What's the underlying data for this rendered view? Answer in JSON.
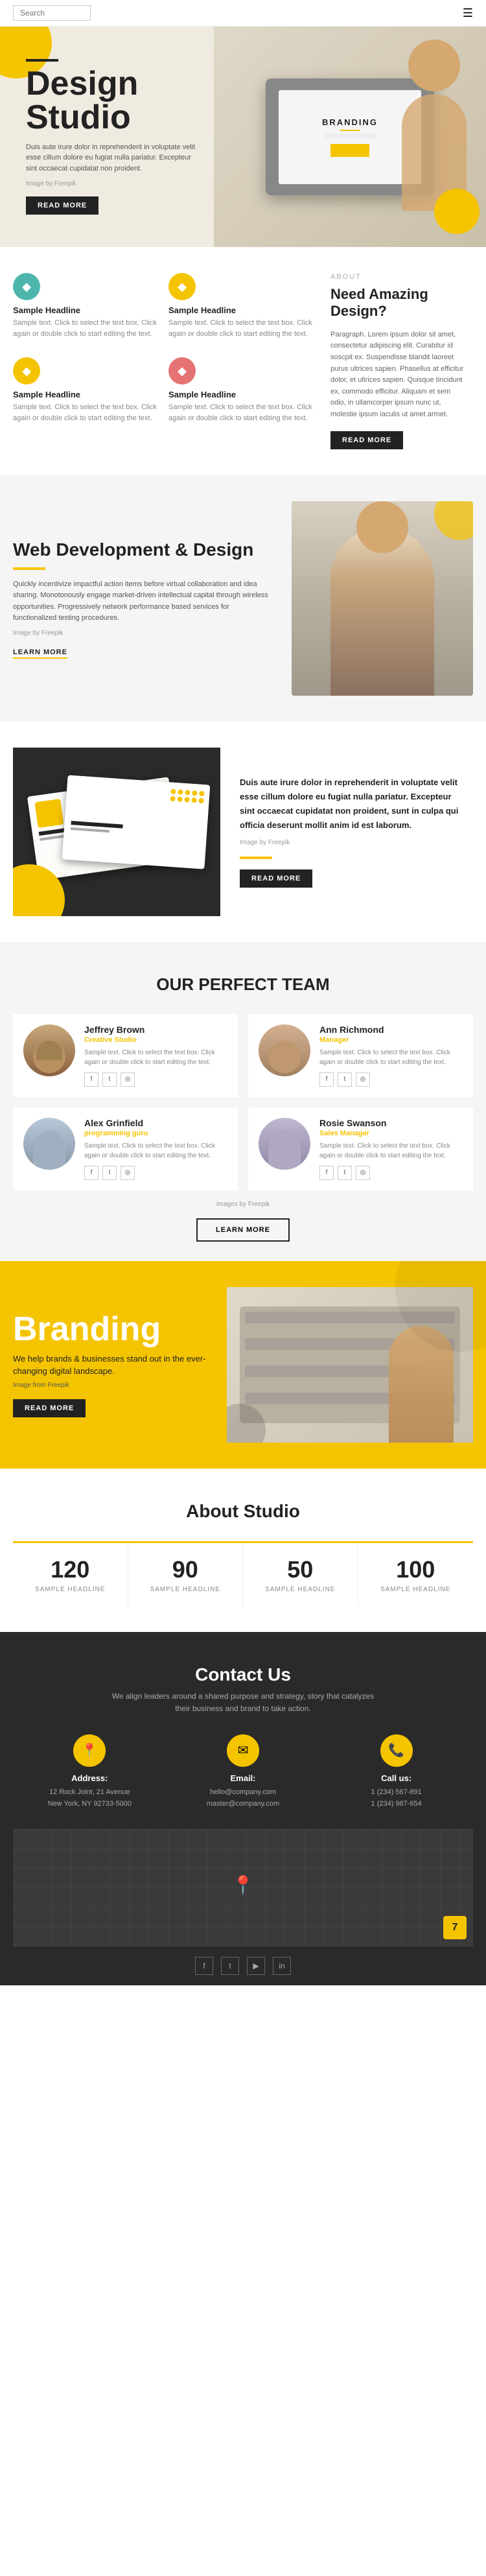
{
  "header": {
    "search_placeholder": "Search",
    "menu_icon": "☰"
  },
  "hero": {
    "title_line1": "Design",
    "title_line2": "Studio",
    "tagline": "Duis aute irure dolor in reprehenderit in voluptate velit esse cillum dolore eu fugiat nulla pariatur. Excepteur sint occaecat cupidatat non proident.",
    "credit": "Image by Freepik",
    "btn_label": "READ MORE",
    "laptop_label": "BRANDING"
  },
  "features": {
    "items_left": [
      {
        "icon": "◆",
        "icon_color": "green",
        "title": "Sample Headline",
        "text": "Sample text. Click to select the text box. Click again or double click to start editing the text."
      },
      {
        "icon": "◆",
        "icon_color": "yellow",
        "title": "Sample Headline",
        "text": "Sample text. Click to select the text box. Click again or double click to start editing the text."
      }
    ],
    "items_middle": [
      {
        "icon": "◆",
        "icon_color": "yellow",
        "title": "Sample Headline",
        "text": "Sample text. Click to select the text box. Click again or double click to start editing the text."
      },
      {
        "icon": "◆",
        "icon_color": "red",
        "title": "Sample Headline",
        "text": "Sample text. Click to select the text box. Click again or double click to start editing the text."
      }
    ],
    "about": {
      "label": "ABOUT",
      "title": "Need Amazing Design?",
      "text": "Paragraph. Lorem ipsum dolor sit amet, consectetur adipiscing elit. Curabitur id soscpit ex. Suspendisse blandit laoreet purus ultrices sapien. Phasellus at efficitur dolor, et ultrices sapien. Quisque tincidunt ex, commodo efficitur. Aliquam et sem odio, in ullamcorper ipsum nunc ut, molestie ipsum iaculis ut amet armet.",
      "btn_label": "READ MORE"
    }
  },
  "webdev": {
    "title": "Web Development & Design",
    "text1": "Quickly incentivize impactful action items before virtual collaboration and idea sharing. Monotonously engage market-driven intellectual capital through wireless opportunities. Progressively network performance based services for functionalized testing procedures.",
    "credit": "Image by Freepik",
    "learn_label": "LEARN MORE"
  },
  "branding_block": {
    "text": "Duis aute irure dolor in reprehenderit in voluptate velit esse cillum dolore eu fugiat nulla pariatur. Excepteur sint occaecat cupidatat non proident, sunt in culpa qui officia deserunt mollit anim id est laborum.",
    "credit": "Image by Freepik",
    "btn_label": "READ MORE"
  },
  "team": {
    "section_title": "OUR PERFECT TEAM",
    "members": [
      {
        "name": "Jeffrey Brown",
        "role": "Creative Studio",
        "desc": "Sample text. Click to select the text box. Click again or double click to start editing the text.",
        "avatar_type": "male"
      },
      {
        "name": "Ann Richmond",
        "role": "Manager",
        "desc": "Sample text. Click to select the text box. Click again or double click to start editing the text.",
        "avatar_type": "female"
      },
      {
        "name": "Alex Grinfield",
        "role": "programming guru",
        "desc": "Sample text. Click to select the text box. Click again or double click to start editing the text.",
        "avatar_type": "male2"
      },
      {
        "name": "Rosie Swanson",
        "role": "Sales Manager",
        "desc": "Sample text. Click to select the text box. Click again or double click to start editing the text.",
        "avatar_type": "female2"
      }
    ],
    "credit": "Images by Freepik",
    "btn_label": "LEARN MORE"
  },
  "branding_section": {
    "heading": "Branding",
    "sub": "We help brands & businesses stand out in the ever-changing digital landscape.",
    "credit": "Image from Freepik",
    "btn_label": "READ MORE"
  },
  "about_studio": {
    "title": "About Studio",
    "stats": [
      {
        "number": "120",
        "label": "SAMPLE HEADLINE"
      },
      {
        "number": "90",
        "label": "SAMPLE HEADLINE"
      },
      {
        "number": "50",
        "label": "SAMPLE HEADLINE"
      },
      {
        "number": "100",
        "label": "SAMPLE HEADLINE"
      }
    ]
  },
  "contact": {
    "title": "Contact Us",
    "desc": "We align leaders around a shared purpose and strategy, story that catalyzes their business and brand to take action.",
    "items": [
      {
        "icon": "📍",
        "label": "Address:",
        "value": "12 Rock Joint, 21 Avenue\nNew York, NY 92733-5000"
      },
      {
        "icon": "✉",
        "label": "Email:",
        "value": "hello@company.com\nmaster@company.com"
      },
      {
        "icon": "📞",
        "label": "Call us:",
        "value": "1 (234) 567-891\n1 (234) 987-654"
      }
    ],
    "social_icons": [
      "f",
      "t",
      "y",
      "in"
    ]
  }
}
